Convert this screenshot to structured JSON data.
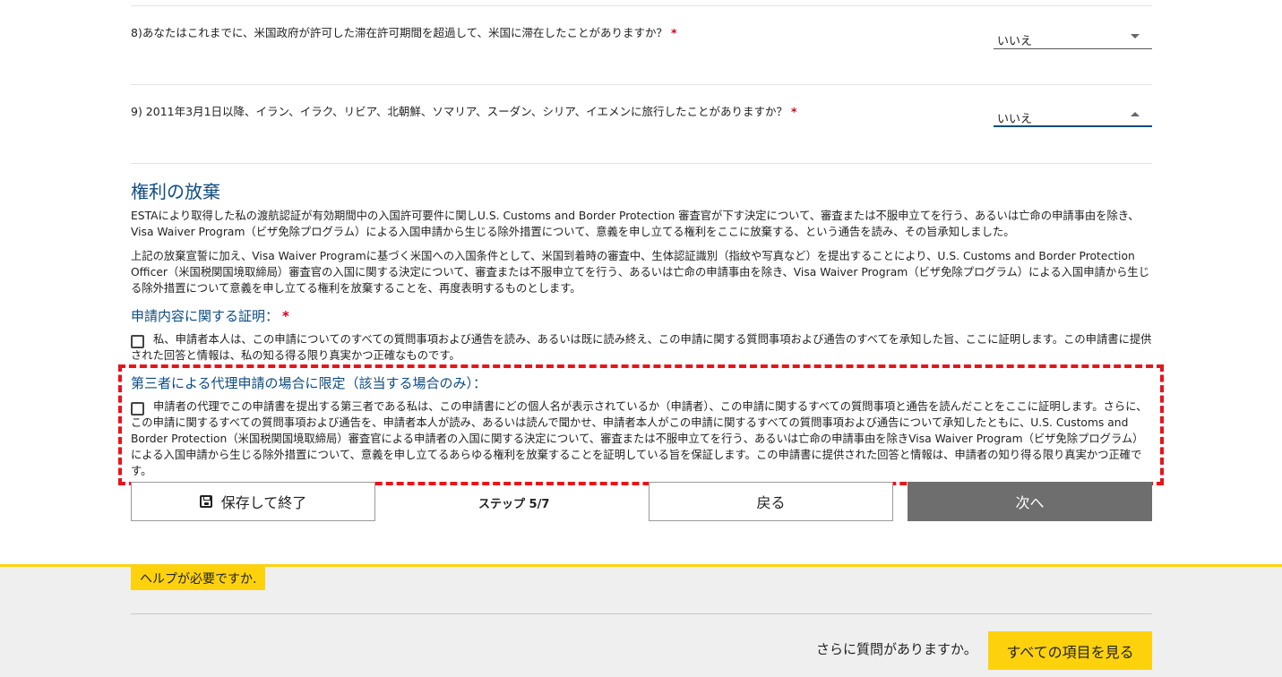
{
  "questions": [
    {
      "text": "8)あなたはこれまでに、米国政府が許可した滞在許可期間を超過して、米国に滞在したことがありますか？",
      "required": "*",
      "answer": "いいえ"
    },
    {
      "text": "9) 2011年3月1日以降、イラン、イラク、リビア、北朝鮮、ソマリア、スーダン、シリア、イエメンに旅行したことがありますか？",
      "required": "*",
      "answer": "いいえ"
    }
  ],
  "waiver": {
    "title": "権利の放棄",
    "para1": "ESTAにより取得した私の渡航認証が有効期間中の入国許可要件に関しU.S. Customs and Border Protection 審査官が下す決定について、審査または不服申立てを行う、あるいは亡命の申請事由を除き、Visa Waiver Program（ビザ免除プログラム）による入国申請から生じる除外措置について、意義を申し立てる権利をここに放棄する、という通告を読み、その旨承知しました。",
    "para2": "上記の放棄宣誓に加え、Visa Waiver Programに基づく米国への入国条件として、米国到着時の審査中、生体認証識別（指紋や写真など）を提出することにより、U.S. Customs and Border Protection Officer（米国税関国境取締局）審査官の入国に関する決定について、審査または不服申立てを行う、あるいは亡命の申請事由を除き、Visa Waiver Program（ビザ免除プログラム）による入国申請から生じる除外措置について意義を申し立てる権利を放棄することを、再度表明するものとします。"
  },
  "certification": {
    "title": "申請内容に関する証明：",
    "required": "*",
    "text": "私、申請者本人は、この申請についてのすべての質問事項および通告を読み、あるいは既に読み終え、この申請に関する質問事項および通告のすべてを承知した旨、ここに証明します。この申請書に提供された回答と情報は、私の知る得る限り真実かつ正確なものです。"
  },
  "third_party": {
    "title": "第三者による代理申請の場合に限定（該当する場合のみ）：",
    "text": "申請者の代理でこの申請書を提出する第三者である私は、この申請書にどの個人名が表示されているか（申請者）、この申請に関するすべての質問事項と通告を読んだことをここに証明します。さらに、この申請に関するすべての質問事項および通告を、申請者本人が読み、あるいは読んで聞かせ、申請者本人がこの申請に関するすべての質問事項および通告について承知したともに、U.S. Customs and Border Protection（米国税関国境取締局）審査官による申請者の入国に関する決定について、審査または不服申立てを行う、あるいは亡命の申請事由を除きVisa Waiver Program（ビザ免除プログラム）による入国申請から生じる除外措置について、意義を申し立てるあらゆる権利を放棄することを証明している旨を保証します。この申請書に提供された回答と情報は、申請者の知り得る限り真実かつ正確です。"
  },
  "nav": {
    "save_label": "保存して終了",
    "step": "ステップ 5/7",
    "back_label": "戻る",
    "next_label": "次へ"
  },
  "footer": {
    "help": "ヘルプが必要ですか.",
    "more_questions": "さらに質問がありますか。",
    "see_all": "すべての項目を見る"
  },
  "colors": {
    "accent_blue": "#0f4c81",
    "required_red": "#d0021b",
    "highlight_red": "#e8141c",
    "help_yellow": "#fdd20d",
    "next_button_gray": "#6e6e6e"
  }
}
